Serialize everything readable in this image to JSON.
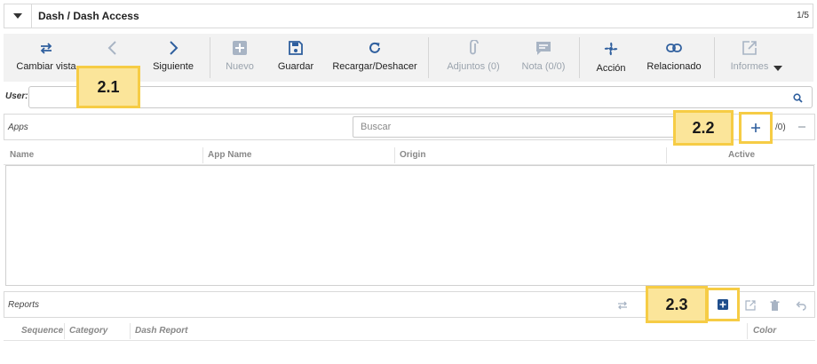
{
  "header": {
    "title": "Dash / Dash Access",
    "record_count": "1/5"
  },
  "toolbar": {
    "switch_view": "Cambiar vista",
    "next": "Siguiente",
    "new": "Nuevo",
    "save": "Guardar",
    "reload": "Recargar/Deshacer",
    "attachments": "Adjuntos (0)",
    "notes": "Nota (0/0)",
    "action": "Acción",
    "related": "Relacionado",
    "reports": "Informes"
  },
  "user_field": {
    "label": "User:",
    "value": ""
  },
  "apps": {
    "title": "Apps",
    "search_placeholder": "Buscar",
    "count": "/0)",
    "columns": [
      "Name",
      "App Name",
      "Origin",
      "Active"
    ]
  },
  "reports_panel": {
    "title": "Reports",
    "columns": [
      "Sequence",
      "Category",
      "Dash Report",
      "Color"
    ]
  },
  "markers": {
    "m1": "2.1",
    "m2": "2.2",
    "m3": "2.3"
  },
  "colors": {
    "accent": "#2f5f9e",
    "marker_fill": "#fbe59a",
    "marker_border": "#f6cc45",
    "disabled": "#9aa3ad"
  },
  "icons": [
    "chevron-down-icon",
    "switch-view-icon",
    "back-icon",
    "next-icon",
    "new-icon",
    "save-icon",
    "reload-icon",
    "attachment-icon",
    "note-icon",
    "action-icon",
    "link-icon",
    "report-icon",
    "search-icon",
    "plus-icon",
    "minus-icon",
    "add-box-icon",
    "open-icon",
    "trash-icon",
    "undo-icon"
  ]
}
